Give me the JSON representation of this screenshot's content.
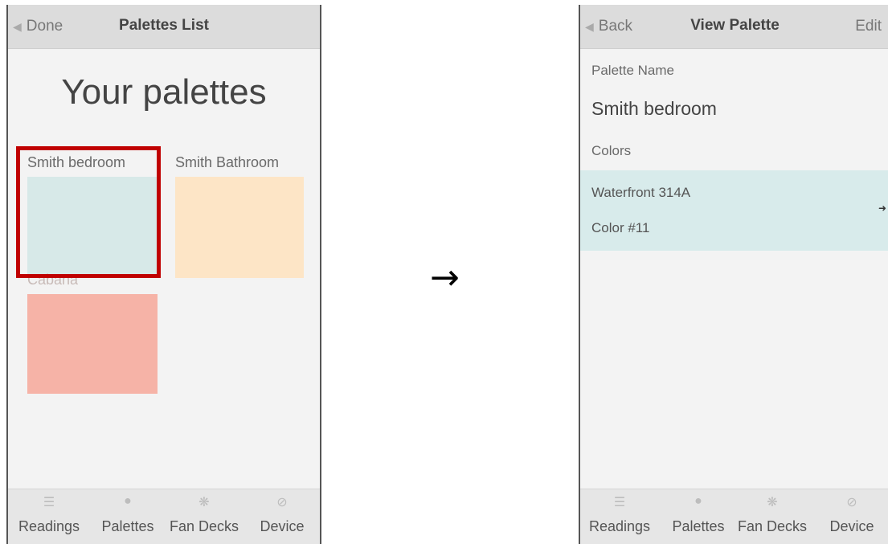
{
  "left_screen": {
    "nav": {
      "back_label": "Done",
      "title": "Palettes List"
    },
    "heading": "Your palettes",
    "palettes": [
      {
        "name": "Smith bedroom",
        "color": "#d7e9e8"
      },
      {
        "name": "Smith Bathroom",
        "color": "#fde5c6"
      },
      {
        "name": "Cabana",
        "color": "#f6b3a7"
      }
    ],
    "highlight_color": "#c00000"
  },
  "right_screen": {
    "nav": {
      "back_label": "Back",
      "title": "View Palette",
      "action_label": "Edit"
    },
    "palette_name_label": "Palette Name",
    "palette_name": "Smith bedroom",
    "colors_label": "Colors",
    "colors": [
      {
        "name": "Waterfront 314A",
        "number": "Color #11",
        "color": "#d8ebeb"
      }
    ]
  },
  "tabs": [
    {
      "label": "Readings",
      "icon": "readings-icon"
    },
    {
      "label": "Palettes",
      "icon": "palettes-icon"
    },
    {
      "label": "Fan Decks",
      "icon": "fan-decks-icon"
    },
    {
      "label": "Device",
      "icon": "device-icon"
    }
  ],
  "transition_arrow": "→"
}
